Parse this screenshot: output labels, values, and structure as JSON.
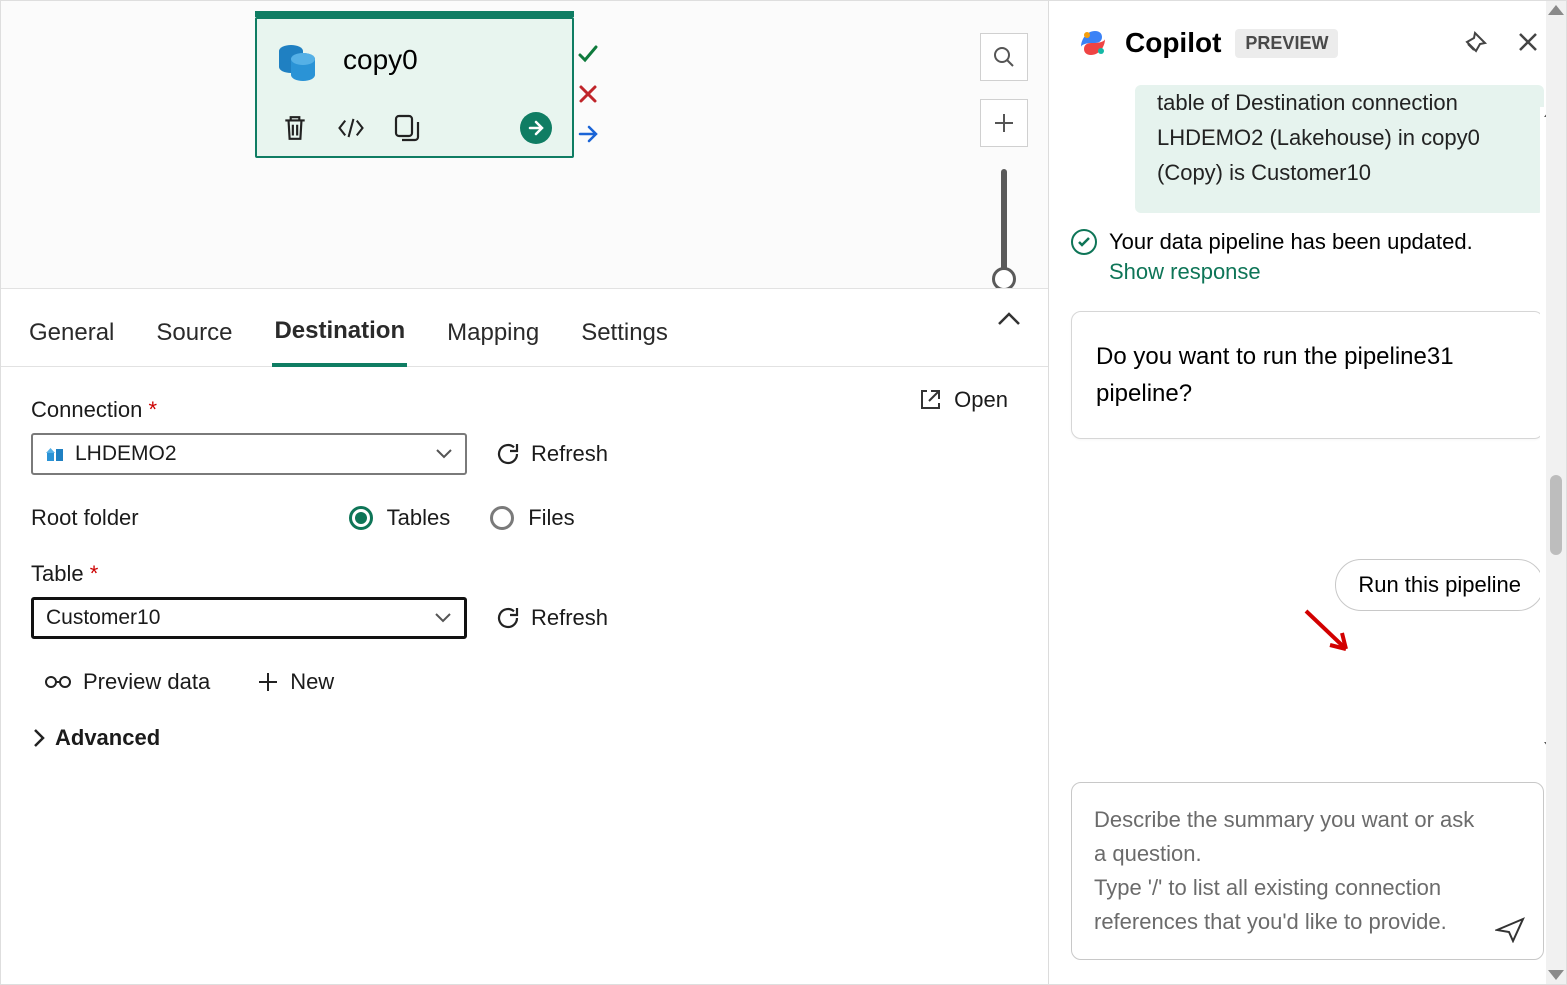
{
  "canvas": {
    "activity_name": "copy0",
    "activity_icon": "copy-data-icon",
    "tools": [
      "trash-icon",
      "code-icon",
      "duplicate-icon"
    ],
    "run_icon": "run-arrow-icon",
    "status_icons": [
      "success-check-icon",
      "error-x-icon",
      "forward-arrow-icon"
    ],
    "search_btn": "search-icon",
    "add_btn": "plus-icon"
  },
  "tabs": {
    "general": "General",
    "source": "Source",
    "destination": "Destination",
    "mapping": "Mapping",
    "settings": "Settings",
    "active": "destination"
  },
  "form": {
    "open_label": "Open",
    "connection_label": "Connection",
    "connection_value": "LHDEMO2",
    "refresh_label": "Refresh",
    "root_folder_label": "Root folder",
    "root_folder_options": {
      "tables": "Tables",
      "files": "Files"
    },
    "root_folder_selected": "tables",
    "table_label": "Table",
    "table_value": "Customer10",
    "preview_label": "Preview data",
    "new_label": "New",
    "advanced_label": "Advanced"
  },
  "copilot": {
    "title": "Copilot",
    "preview_badge": "PREVIEW",
    "pin_icon": "pin-icon",
    "close_icon": "close-icon",
    "green_message": "table of Destination connection LHDEMO2 (Lakehouse) in copy0 (Copy) is Customer10",
    "status_message": "Your data pipeline has been updated.",
    "show_response": "Show response",
    "question": "Do you want to run the pipeline31 pipeline?",
    "run_button": "Run this pipeline",
    "input_placeholder": "Describe the summary you want or ask a question.\nType '/' to list all existing connection references that you'd like to provide.",
    "send_icon": "send-icon"
  }
}
